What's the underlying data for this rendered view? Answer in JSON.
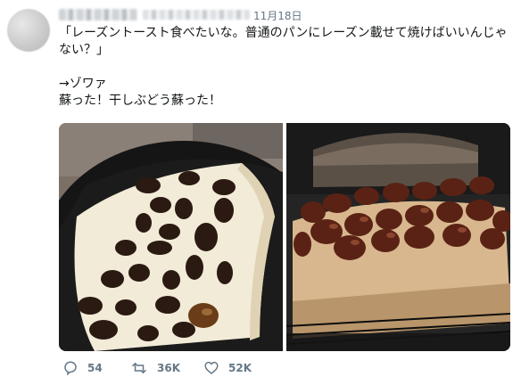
{
  "tweet": {
    "date": "11月18日",
    "text_lines": [
      "「レーズントースト食べたいな。普通のパンにレーズン載せて焼けばいいんじゃ",
      "ない？」",
      "",
      "→ゾワァ",
      "蘇った！干しぶどう蘇った！"
    ],
    "images": [
      "raisins-on-bread-before-toasting",
      "raisins-on-bread-after-toasting"
    ]
  },
  "actions": {
    "reply_count": "54",
    "retweet_count": "36K",
    "like_count": "52K"
  },
  "colors": {
    "text": "#14171a",
    "secondary": "#657786",
    "background": "#ffffff"
  },
  "icons": [
    "reply-icon",
    "retweet-icon",
    "like-icon"
  ]
}
